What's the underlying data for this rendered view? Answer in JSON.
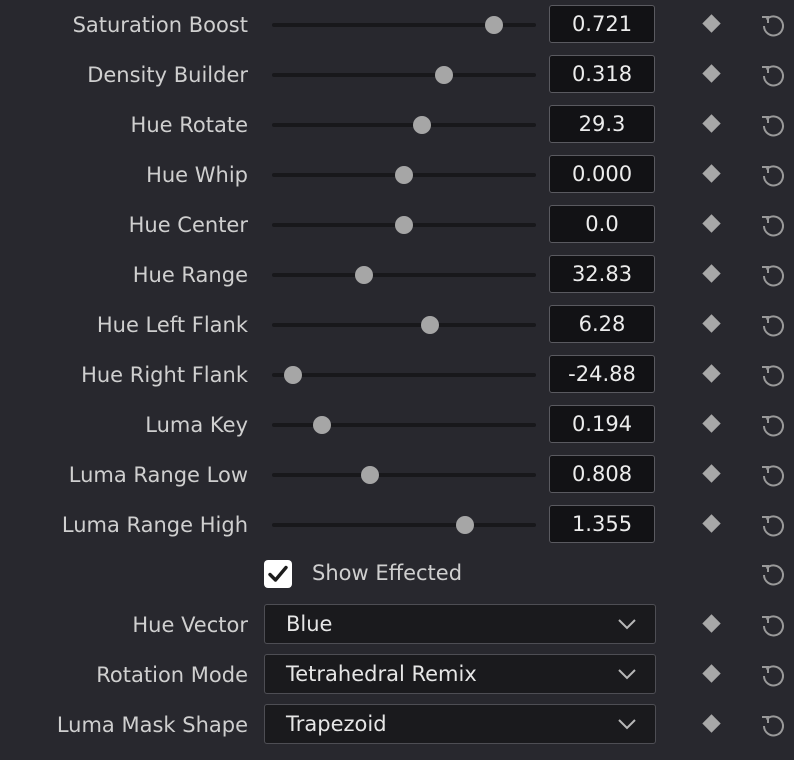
{
  "sliders": [
    {
      "label": "Saturation Boost",
      "value": "0.721",
      "position": 0.84
    },
    {
      "label": "Density Builder",
      "value": "0.318",
      "position": 0.65
    },
    {
      "label": "Hue Rotate",
      "value": "29.3",
      "position": 0.57
    },
    {
      "label": "Hue Whip",
      "value": "0.000",
      "position": 0.5
    },
    {
      "label": "Hue Center",
      "value": "0.0",
      "position": 0.5
    },
    {
      "label": "Hue Range",
      "value": "32.83",
      "position": 0.35
    },
    {
      "label": "Hue Left Flank",
      "value": "6.28",
      "position": 0.6
    },
    {
      "label": "Hue Right Flank",
      "value": "-24.88",
      "position": 0.08
    },
    {
      "label": "Luma Key",
      "value": "0.194",
      "position": 0.19
    },
    {
      "label": "Luma Range Low",
      "value": "0.808",
      "position": 0.37
    },
    {
      "label": "Luma Range High",
      "value": "1.355",
      "position": 0.73
    }
  ],
  "show_effected": {
    "label": "Show Effected",
    "checked": true
  },
  "dropdowns": [
    {
      "label": "Hue Vector",
      "value": "Blue"
    },
    {
      "label": "Rotation Mode",
      "value": "Tetrahedral Remix"
    },
    {
      "label": "Luma Mask Shape",
      "value": "Trapezoid"
    }
  ],
  "icons": {
    "keyframe": "keyframe-diamond-icon",
    "reset": "reset-icon",
    "checkmark": "checkmark-icon",
    "chevron": "chevron-down-icon"
  },
  "colors": {
    "background": "#28282e",
    "field": "#121215",
    "thumb": "#a6a6a6"
  }
}
